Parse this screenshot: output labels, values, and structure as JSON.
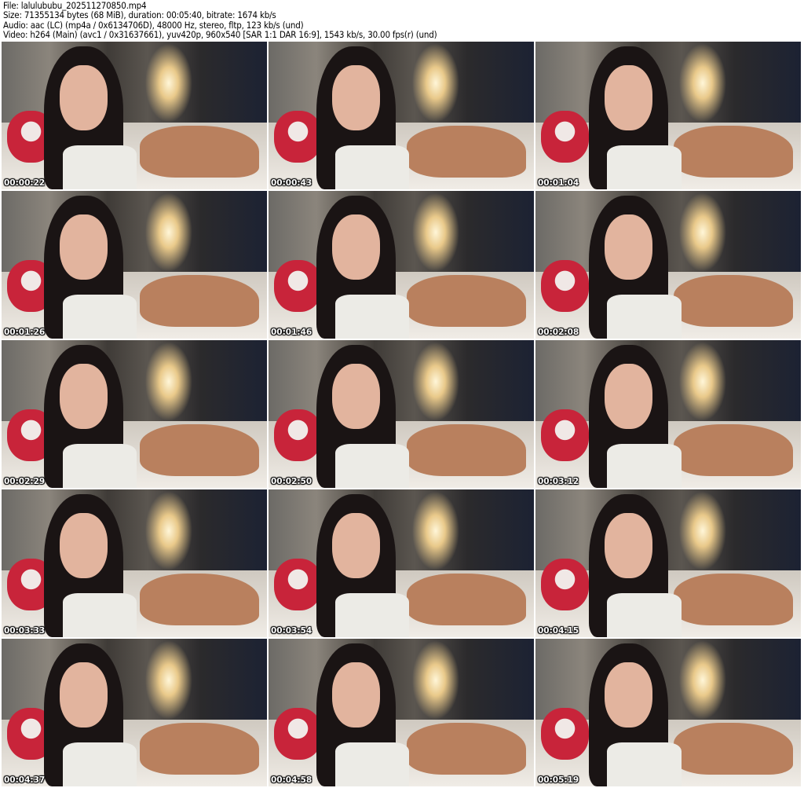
{
  "header": {
    "file": "File: lalulububu_202511270850.mp4",
    "size": "Size: 71355134 bytes (68 MiB), duration: 00:05:40, bitrate: 1674 kb/s",
    "audio": "Audio: aac (LC) (mp4a / 0x6134706D), 48000 Hz, stereo, fltp, 123 kb/s (und)",
    "video": "Video: h264 (Main) (avc1 / 0x31637661), yuv420p, 960x540 [SAR 1:1 DAR 16:9], 1543 kb/s, 30.00 fps(r) (und)"
  },
  "thumbnails": [
    {
      "timestamp": "00:00:22"
    },
    {
      "timestamp": "00:00:43"
    },
    {
      "timestamp": "00:01:04"
    },
    {
      "timestamp": "00:01:26"
    },
    {
      "timestamp": "00:01:46"
    },
    {
      "timestamp": "00:02:08"
    },
    {
      "timestamp": "00:02:29"
    },
    {
      "timestamp": "00:02:50"
    },
    {
      "timestamp": "00:03:12"
    },
    {
      "timestamp": "00:03:33"
    },
    {
      "timestamp": "00:03:54"
    },
    {
      "timestamp": "00:04:15"
    },
    {
      "timestamp": "00:04:37"
    },
    {
      "timestamp": "00:04:58"
    },
    {
      "timestamp": "00:05:19"
    }
  ]
}
